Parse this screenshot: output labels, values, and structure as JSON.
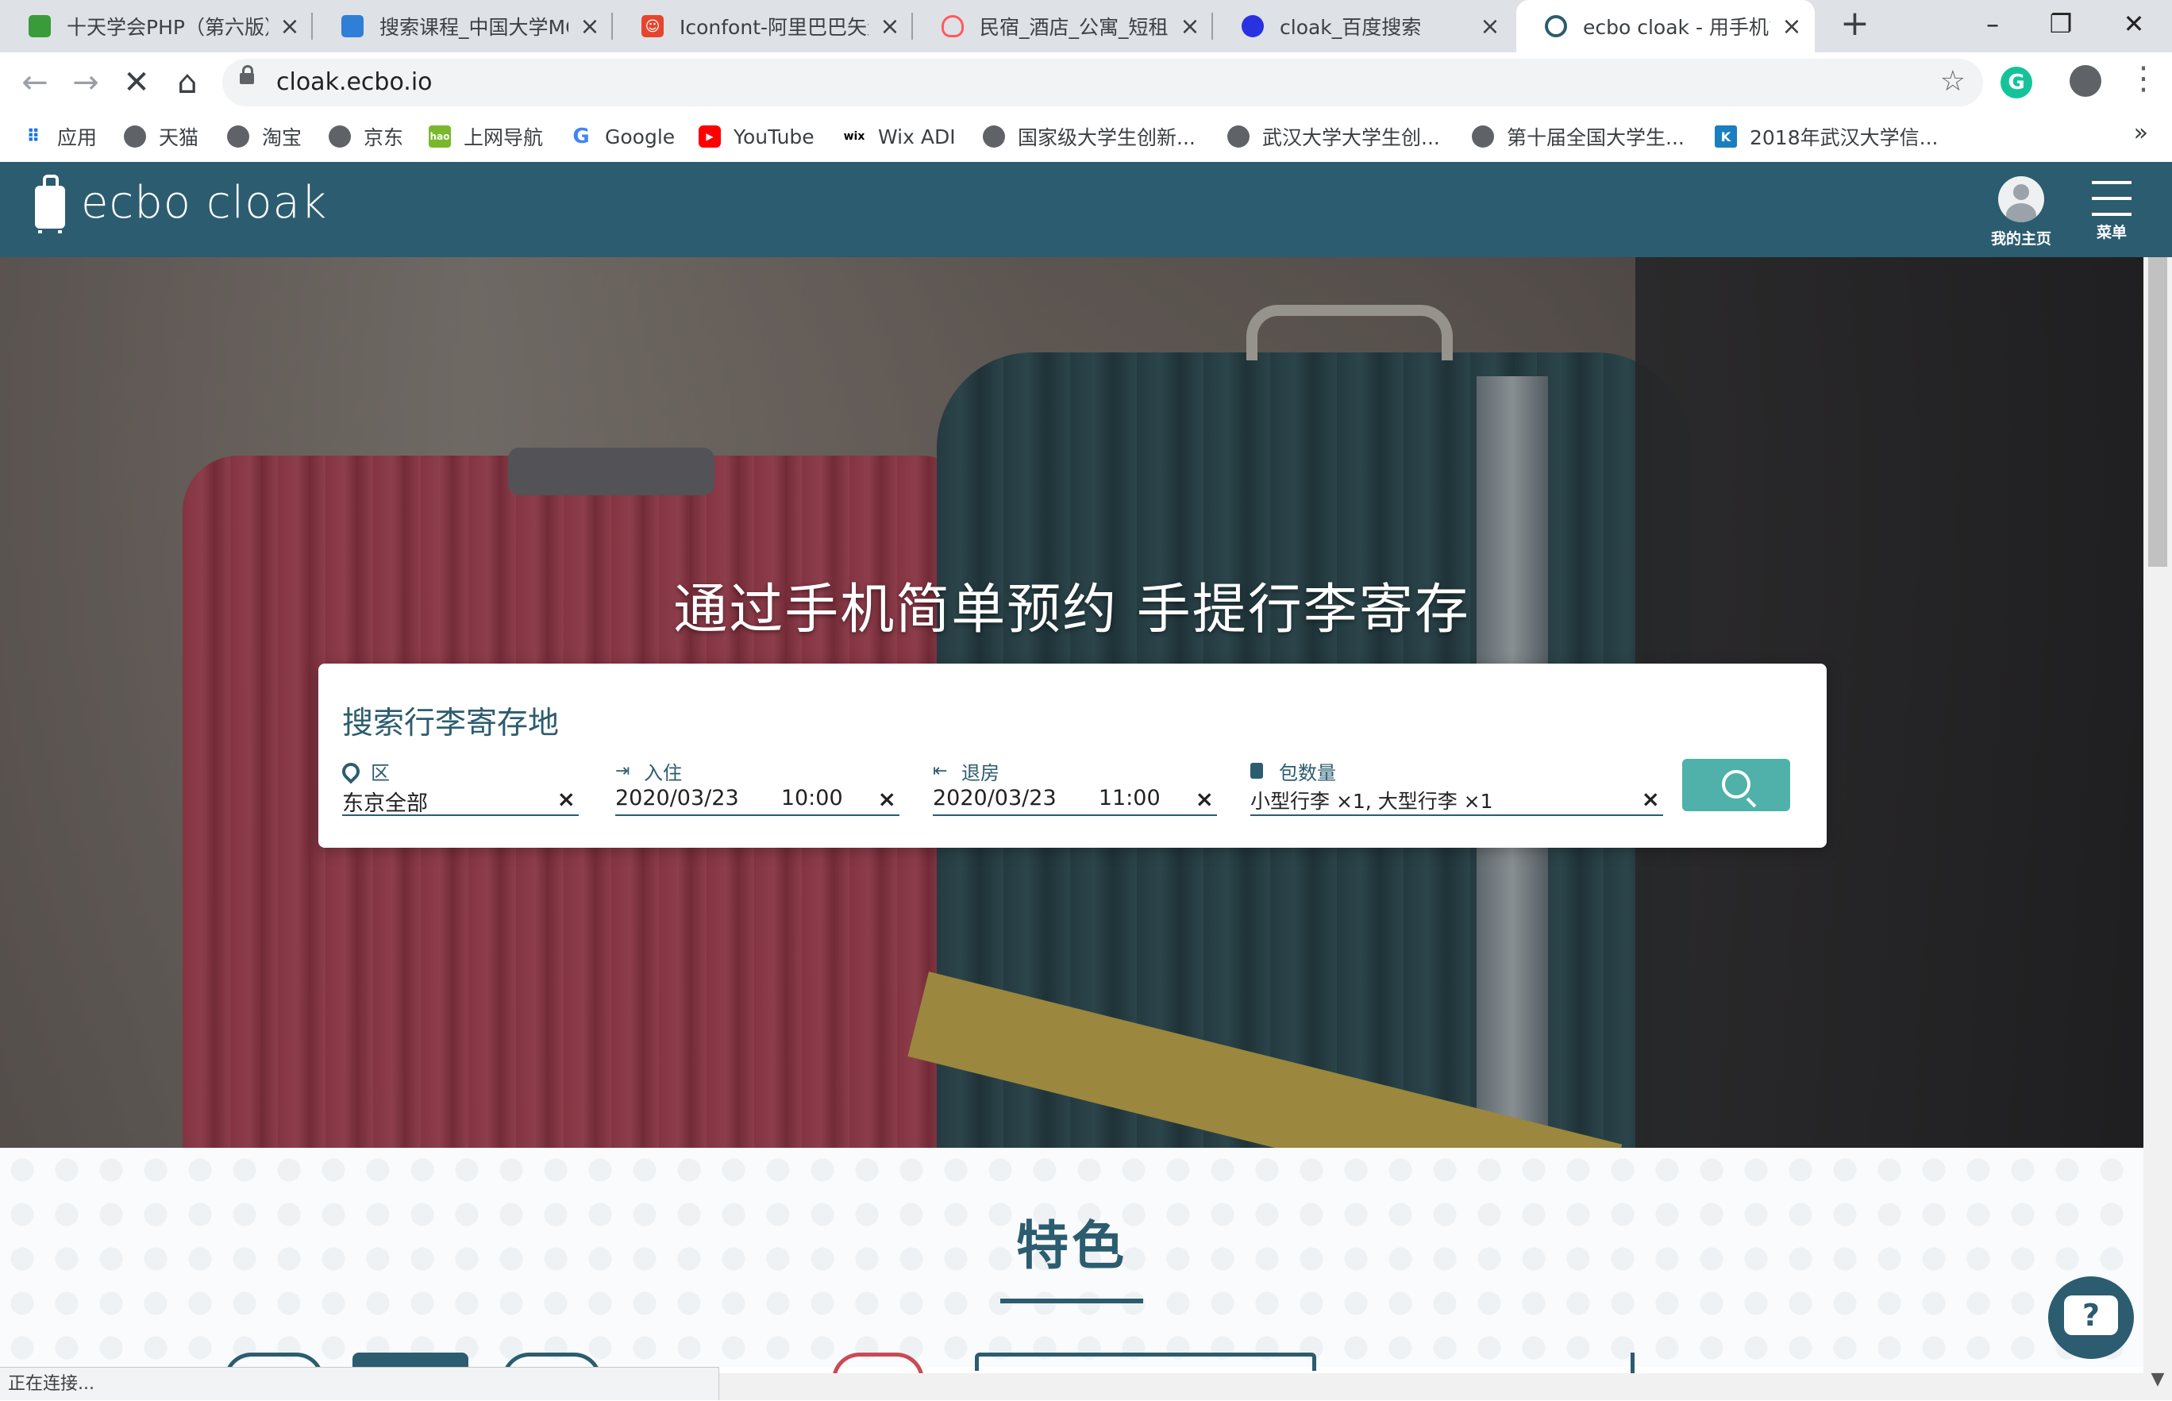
{
  "browser": {
    "tabs": [
      {
        "title": "十天学会PHP（第六版）",
        "favicon": "green-book-icon",
        "color": "#3a9b3a"
      },
      {
        "title": "搜索课程_中国大学MOOC",
        "favicon": "mooc-flag-icon",
        "color": "#2f7fd6"
      },
      {
        "title": "Iconfont-阿里巴巴矢量",
        "favicon": "iconfont-icon",
        "color": "#e6452d"
      },
      {
        "title": "民宿_酒店_公寓_短租住",
        "favicon": "airbnb-icon",
        "color": "#ff5a5f"
      },
      {
        "title": "cloak_百度搜索",
        "favicon": "baidu-paw-icon",
        "color": "#2932e1"
      },
      {
        "title": "ecbo cloak - 用手机简",
        "favicon": "ecbo-icon",
        "color": "#2c5c6f",
        "active": true
      }
    ],
    "url": "cloak.ecbo.io",
    "bookmarks": [
      {
        "label": "应用",
        "icon": "apps-grid-icon"
      },
      {
        "label": "天猫",
        "icon": "globe-icon"
      },
      {
        "label": "淘宝",
        "icon": "globe-icon"
      },
      {
        "label": "京东",
        "icon": "globe-icon"
      },
      {
        "label": "上网导航",
        "icon": "hao-icon"
      },
      {
        "label": "Google",
        "icon": "google-icon"
      },
      {
        "label": "YouTube",
        "icon": "youtube-icon"
      },
      {
        "label": "Wix ADI",
        "icon": "wix-icon"
      },
      {
        "label": "国家级大学生创新...",
        "icon": "globe-icon"
      },
      {
        "label": "武汉大学大学生创...",
        "icon": "globe-icon"
      },
      {
        "label": "第十届全国大学生...",
        "icon": "globe-icon"
      },
      {
        "label": "2018年武汉大学信...",
        "icon": "k-icon"
      }
    ],
    "more_bookmarks": "»",
    "status_text": "正在连接..."
  },
  "site": {
    "logo_text": "ecbo cloak",
    "my_page_label": "我的主页",
    "menu_label": "菜单",
    "accent": "#2c5c6f",
    "button_color": "#4fb1aa"
  },
  "hero": {
    "title": "通过手机简单预约 手提行李寄存"
  },
  "search": {
    "heading": "搜索行李寄存地",
    "area": {
      "label": "区",
      "value": "东京全部"
    },
    "checkin": {
      "label": "入住",
      "date": "2020/03/23",
      "time": "10:00"
    },
    "checkout": {
      "label": "退房",
      "date": "2020/03/23",
      "time": "11:00"
    },
    "bags": {
      "label": "包数量",
      "value": "小型行李 ×1, 大型行李 ×1"
    },
    "clear_glyph": "×"
  },
  "features": {
    "title": "特色"
  },
  "help": {
    "glyph": "?"
  }
}
